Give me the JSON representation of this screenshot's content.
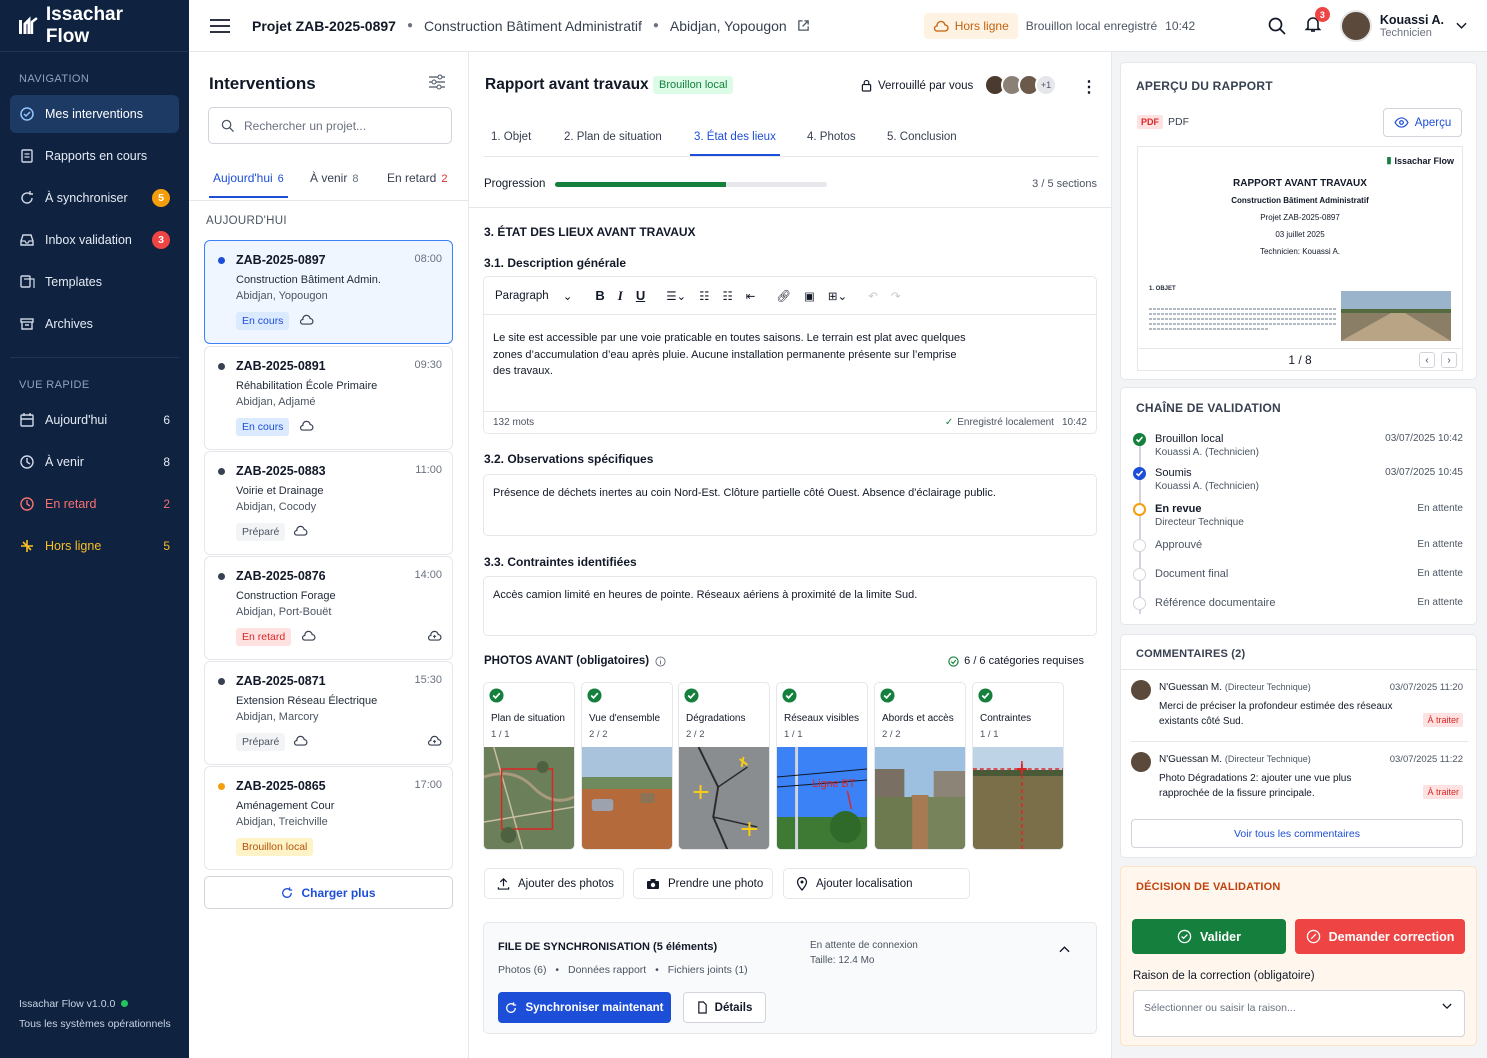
{
  "app": {
    "name": "Issachar Flow",
    "version": "Issachar Flow v1.0.0",
    "status": "Tous les systèmes opérationnels"
  },
  "nav": {
    "section_label": "NAVIGATION",
    "items": [
      {
        "label": "Mes interventions"
      },
      {
        "label": "Rapports en cours"
      },
      {
        "label": "À synchroniser",
        "badge": "5"
      },
      {
        "label": "Inbox validation",
        "badge": "3"
      },
      {
        "label": "Templates"
      },
      {
        "label": "Archives"
      }
    ],
    "quick_label": "VUE RAPIDE",
    "quick": [
      {
        "label": "Aujourd'hui",
        "count": "6"
      },
      {
        "label": "À venir",
        "count": "8"
      },
      {
        "label": "En retard",
        "count": "2"
      },
      {
        "label": "Hors ligne",
        "count": "5"
      }
    ]
  },
  "topbar": {
    "project": "Projet ZAB-2025-0897",
    "site": "Construction Bâtiment Administratif",
    "location": "Abidjan, Yopougon",
    "offline": "Hors ligne",
    "saved": "Brouillon local enregistré",
    "saved_time": "10:42",
    "notif_count": "3",
    "user_name": "Kouassi A.",
    "user_role": "Technicien"
  },
  "interventions": {
    "title": "Interventions",
    "search_placeholder": "Rechercher un projet...",
    "tabs": [
      {
        "label": "Aujourd'hui",
        "count": "6"
      },
      {
        "label": "À venir",
        "count": "8"
      },
      {
        "label": "En retard",
        "count": "2"
      }
    ],
    "group": "AUJOURD'HUI",
    "cards": [
      {
        "id": "ZAB-2025-0897",
        "time": "08:00",
        "title": "Construction Bâtiment Admin.",
        "place": "Abidjan, Yopougon",
        "status": "En cours"
      },
      {
        "id": "ZAB-2025-0891",
        "time": "09:30",
        "title": "Réhabilitation École Primaire",
        "place": "Abidjan, Adjamé",
        "status": "En cours"
      },
      {
        "id": "ZAB-2025-0883",
        "time": "11:00",
        "title": "Voirie et Drainage",
        "place": "Abidjan, Cocody",
        "status": "Préparé"
      },
      {
        "id": "ZAB-2025-0876",
        "time": "14:00",
        "title": "Construction Forage",
        "place": "Abidjan, Port-Bouët",
        "status": "En retard"
      },
      {
        "id": "ZAB-2025-0871",
        "time": "15:30",
        "title": "Extension Réseau Électrique",
        "place": "Abidjan, Marcory",
        "status": "Préparé"
      },
      {
        "id": "ZAB-2025-0865",
        "time": "17:00",
        "title": "Aménagement Cour",
        "place": "Abidjan, Treichville",
        "status": "Brouillon local"
      }
    ],
    "load_more": "Charger plus"
  },
  "report": {
    "title": "Rapport avant travaux",
    "badge": "Brouillon local",
    "lock": "Verrouillé par vous",
    "extra_users": "+1",
    "steps": [
      "1. Objet",
      "2. Plan de situation",
      "3. État des lieux",
      "4. Photos",
      "5. Conclusion"
    ],
    "progress_label": "Progression",
    "progress": 0.63,
    "sections_count": "3 / 5 sections",
    "section_title": "3. ÉTAT DES LIEUX AVANT TRAVAUX",
    "desc_title": "3.1. Description générale",
    "paragraph": "Paragraph",
    "desc_text": "Le site est accessible par une voie praticable en toutes saisons. Le terrain est plat avec quelques zones d’accumulation d’eau après pluie. Aucune installation permanente présente sur l’emprise des travaux.",
    "words": "132 mots",
    "saved_local": "Enregistré localement",
    "saved_local_time": "10:42",
    "obs_title": "3.2. Observations spécifiques",
    "obs_text": "Présence de déchets inertes au coin Nord-Est. Clôture partielle côté Ouest. Absence d'éclairage public.",
    "cons_title": "3.3. Contraintes identifiées",
    "cons_text": "Accès camion limité en heures de pointe. Réseaux aériens à proximité de la limite Sud.",
    "photos_title": "PHOTOS AVANT (obligatoires)",
    "photos_ok": "6 / 6 catégories requises",
    "photo_cats": [
      {
        "name": "Plan de situation",
        "count": "1 / 1"
      },
      {
        "name": "Vue d'ensemble",
        "count": "2 / 2"
      },
      {
        "name": "Dégradations",
        "count": "2 / 2"
      },
      {
        "name": "Réseaux visibles",
        "count": "1 / 1",
        "label": "Ligne BT"
      },
      {
        "name": "Abords et accès",
        "count": "2 / 2"
      },
      {
        "name": "Contraintes",
        "count": "1 / 1"
      }
    ],
    "actions": [
      "Ajouter des photos",
      "Prendre une photo",
      "Ajouter localisation"
    ],
    "sync_title": "FILE DE SYNCHRONISATION (5 éléments)",
    "sync_items": [
      "Photos (6)",
      "Données rapport",
      "Fichiers joints (1)"
    ],
    "sync_wait": "En attente de connexion",
    "sync_size": "Taille: 12.4 Mo",
    "sync_now": "Synchroniser maintenant",
    "details": "Détails"
  },
  "preview": {
    "title": "APERÇU DU RAPPORT",
    "pdf_badge": "PDF",
    "pdf_label": "PDF",
    "button": "Aperçu",
    "doc_logo": "Issachar Flow",
    "doc_title": "RAPPORT AVANT TRAVAUX",
    "doc_sub": "Construction Bâtiment Administratif",
    "doc_proj": "Projet ZAB-2025-0897",
    "doc_date": "03 juillet 2025",
    "doc_tech": "Technicien: Kouassi A.",
    "doc_section": "1. OBJET",
    "page": "1 / 8"
  },
  "validation": {
    "title": "CHAÎNE DE VALIDATION",
    "steps": [
      {
        "label": "Brouillon local",
        "sub": "Kouassi A. (Technicien)",
        "date": "03/07/2025 10:42",
        "state": "done"
      },
      {
        "label": "Soumis",
        "sub": "Kouassi A. (Technicien)",
        "date": "03/07/2025 10:45",
        "state": "done"
      },
      {
        "label": "En revue",
        "sub": "Directeur Technique",
        "date": "En attente",
        "state": "current"
      },
      {
        "label": "Approuvé",
        "sub": "",
        "date": "En attente",
        "state": "pending"
      },
      {
        "label": "Document final",
        "sub": "",
        "date": "En attente",
        "state": "pending"
      },
      {
        "label": "Référence documentaire",
        "sub": "",
        "date": "En attente",
        "state": "pending"
      }
    ]
  },
  "comments": {
    "title": "COMMENTAIRES (2)",
    "items": [
      {
        "author": "N'Guessan M.",
        "role": "(Directeur Technique)",
        "date": "03/07/2025 11:20",
        "text": "Merci de préciser la profondeur estimée des réseaux existants côté Sud.",
        "tag": "À traiter"
      },
      {
        "author": "N'Guessan M.",
        "role": "(Directeur Technique)",
        "date": "03/07/2025 11:22",
        "text": "Photo Dégradations 2: ajouter une vue plus rapprochée de la fissure principale.",
        "tag": "À traiter"
      }
    ],
    "see_all": "Voir tous les commentaires"
  },
  "decision": {
    "title": "DÉCISION DE VALIDATION",
    "validate": "Valider",
    "correction": "Demander correction",
    "reason_label": "Raison de la correction (obligatoire)",
    "reason_placeholder": "Sélectionner ou saisir la raison..."
  },
  "colors": {
    "sidebar": "#0f2240",
    "primary": "#1d4ed8",
    "success": "#15803d",
    "danger": "#ef4444",
    "warning": "#f59e0b"
  }
}
